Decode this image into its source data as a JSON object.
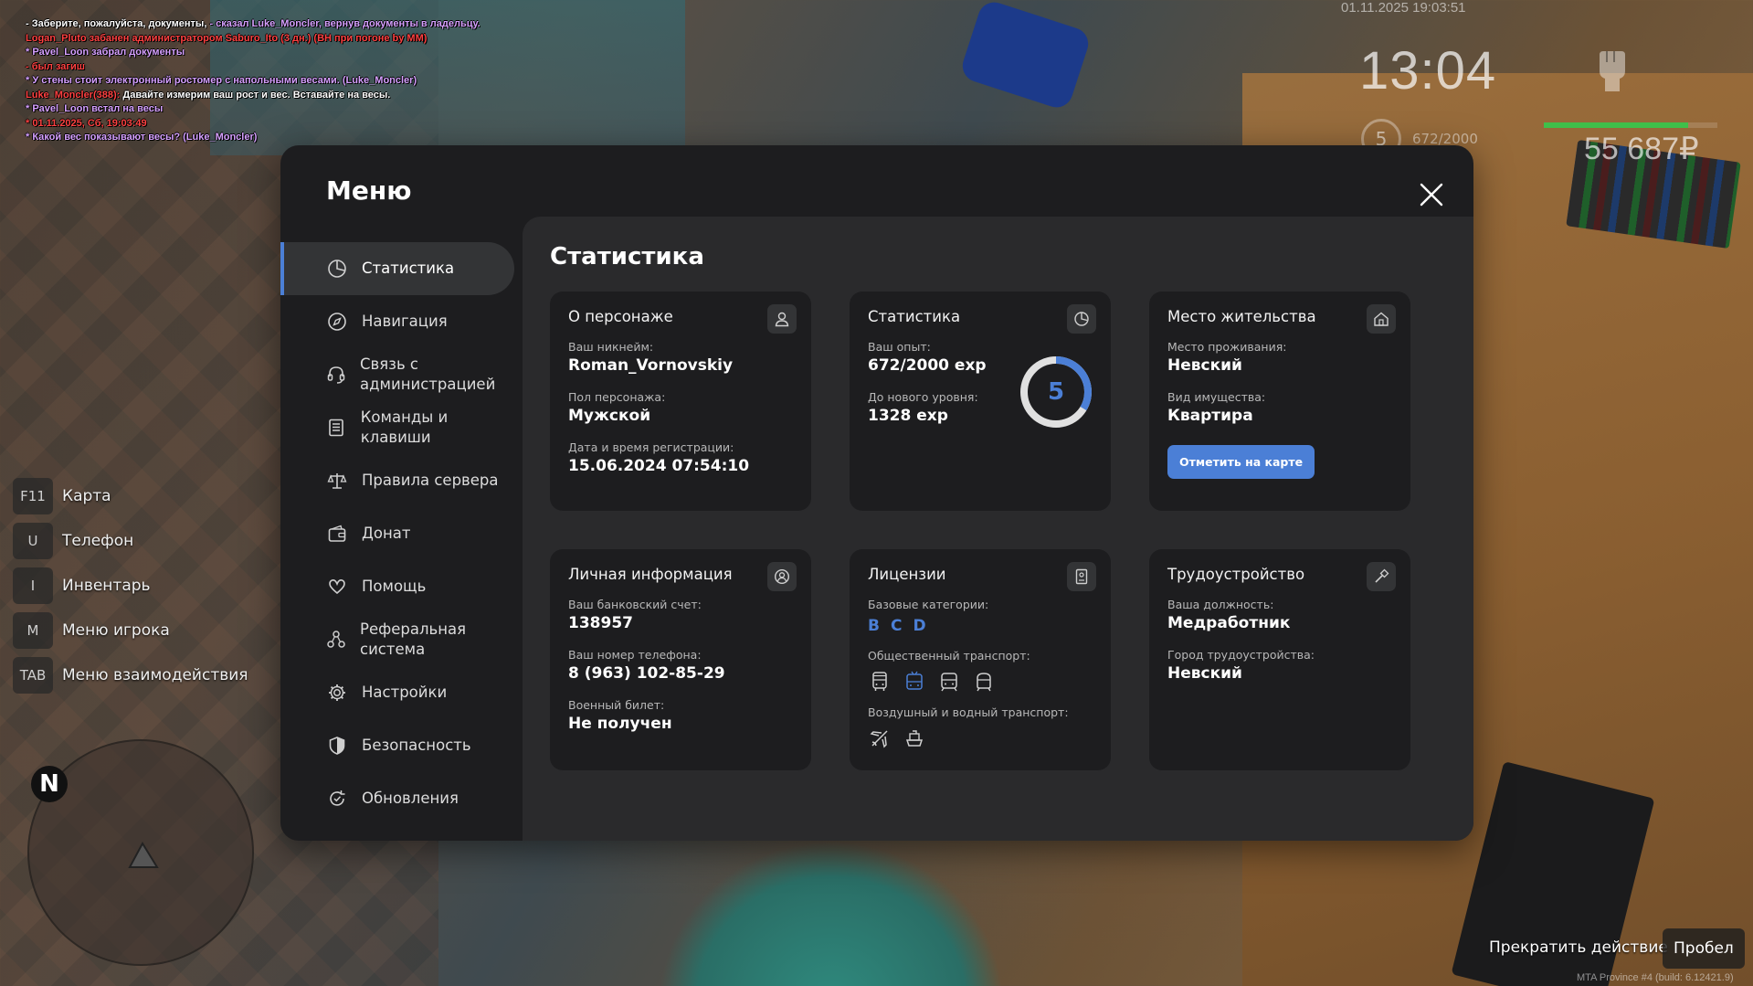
{
  "chat": [
    {
      "text": "- Заберите, пожалуйста, документы, ",
      "color": "#ffffff",
      "rest": "- сказал Luke_Moncler, вернув документы в ладельцу.",
      "rest_color": "#d6a0ff"
    },
    {
      "text": "Logan_Pluto забанен администратором Saburo_Ito (3 дн.) (ВН при погоне by MM)",
      "color": "#ff4141"
    },
    {
      "text": "* Pavel_Loon забрал документы",
      "color": "#d6a0ff"
    },
    {
      "text": "- был загиш",
      "color": "#ff4141"
    },
    {
      "text": "* У стены стоит электронный ростомер с напольными весами. (Luke_Moncler)",
      "color": "#d6a0ff"
    },
    {
      "text": "Luke_Moncler(388): ",
      "color": "#ff4141",
      "rest": "Давайте измерим ваш рост и вес. Вставайте на весы.",
      "rest_color": "#ffffff"
    },
    {
      "text": "* Pavel_Loon встал на весы",
      "color": "#d6a0ff"
    },
    {
      "text": "* 01.11.2025, Сб, 19:03:49",
      "color": "#ff4141"
    },
    {
      "text": "* Какой вес показывают весы? (Luke_Moncler)",
      "color": "#d6a0ff"
    }
  ],
  "hud": {
    "date": "01.11.2025 19:03:51",
    "time": "13:04",
    "level": "5",
    "exp": "672/2000",
    "money": "55 687₽",
    "health_fraction": 0.83
  },
  "keybinds": [
    {
      "key": "F11",
      "label": "Карта"
    },
    {
      "key": "U",
      "label": "Телефон"
    },
    {
      "key": "I",
      "label": "Инвентарь"
    },
    {
      "key": "M",
      "label": "Меню игрока"
    },
    {
      "key": "TAB",
      "label": "Меню взаимодействия"
    }
  ],
  "radar": {
    "north": "N"
  },
  "hints": {
    "stop": "Прекратить действие",
    "space": "Пробел",
    "build": "MTA Province #4 (build: 6.12421.9)"
  },
  "menu": {
    "title": "Меню",
    "sidebar": [
      {
        "label": "Статистика",
        "icon": "stats-icon",
        "active": true
      },
      {
        "label": "Навигация",
        "icon": "compass-icon"
      },
      {
        "label": "Связь с администрацией",
        "icon": "headset-icon"
      },
      {
        "label": "Команды и клавиши",
        "icon": "document-icon"
      },
      {
        "label": "Правила сервера",
        "icon": "scales-icon"
      },
      {
        "label": "Донат",
        "icon": "wallet-icon"
      },
      {
        "label": "Помощь",
        "icon": "heart-hand-icon"
      },
      {
        "label": "Реферальная система",
        "icon": "referral-icon"
      },
      {
        "label": "Настройки",
        "icon": "gear-icon"
      },
      {
        "label": "Безопасность",
        "icon": "shield-icon"
      },
      {
        "label": "Обновления",
        "icon": "refresh-icon"
      }
    ],
    "content_title": "Статистика",
    "cards": {
      "character": {
        "title": "О персонаже",
        "nickname_label": "Ваш никнейм:",
        "nickname": "Roman_Vornovskiy",
        "gender_label": "Пол персонажа:",
        "gender": "Мужской",
        "reg_label": "Дата и время регистрации:",
        "reg": "15.06.2024 07:54:10"
      },
      "stats": {
        "title": "Статистика",
        "exp_label": "Ваш опыт:",
        "exp": "672/2000 exp",
        "next_label": "До нового уровня:",
        "next": "1328 exp",
        "level": "5",
        "progress": 0.336
      },
      "residence": {
        "title": "Место жительства",
        "place_label": "Место проживания:",
        "place": "Невский",
        "property_label": "Вид имущества:",
        "property": "Квартира",
        "button": "Отметить на карте"
      },
      "personal": {
        "title": "Личная информация",
        "bank_label": "Ваш банковский счет:",
        "bank": "138957",
        "phone_label": "Ваш номер телефона:",
        "phone": "8 (963) 102-85-29",
        "military_label": "Военный билет:",
        "military": "Не получен"
      },
      "licenses": {
        "title": "Лицензии",
        "base_label": "Базовые категории:",
        "base": [
          "B",
          "C",
          "D"
        ],
        "public_label": "Общественный транспорт:",
        "air_label": "Воздушный и водный транспорт:"
      },
      "job": {
        "title": "Трудоустройство",
        "position_label": "Ваша должность:",
        "position": "Медработник",
        "city_label": "Город трудоустройства:",
        "city": "Невский"
      }
    }
  },
  "colors": {
    "accent": "#4b7fd6",
    "panel": "#1d1d1f",
    "content": "#2a2a2c"
  }
}
